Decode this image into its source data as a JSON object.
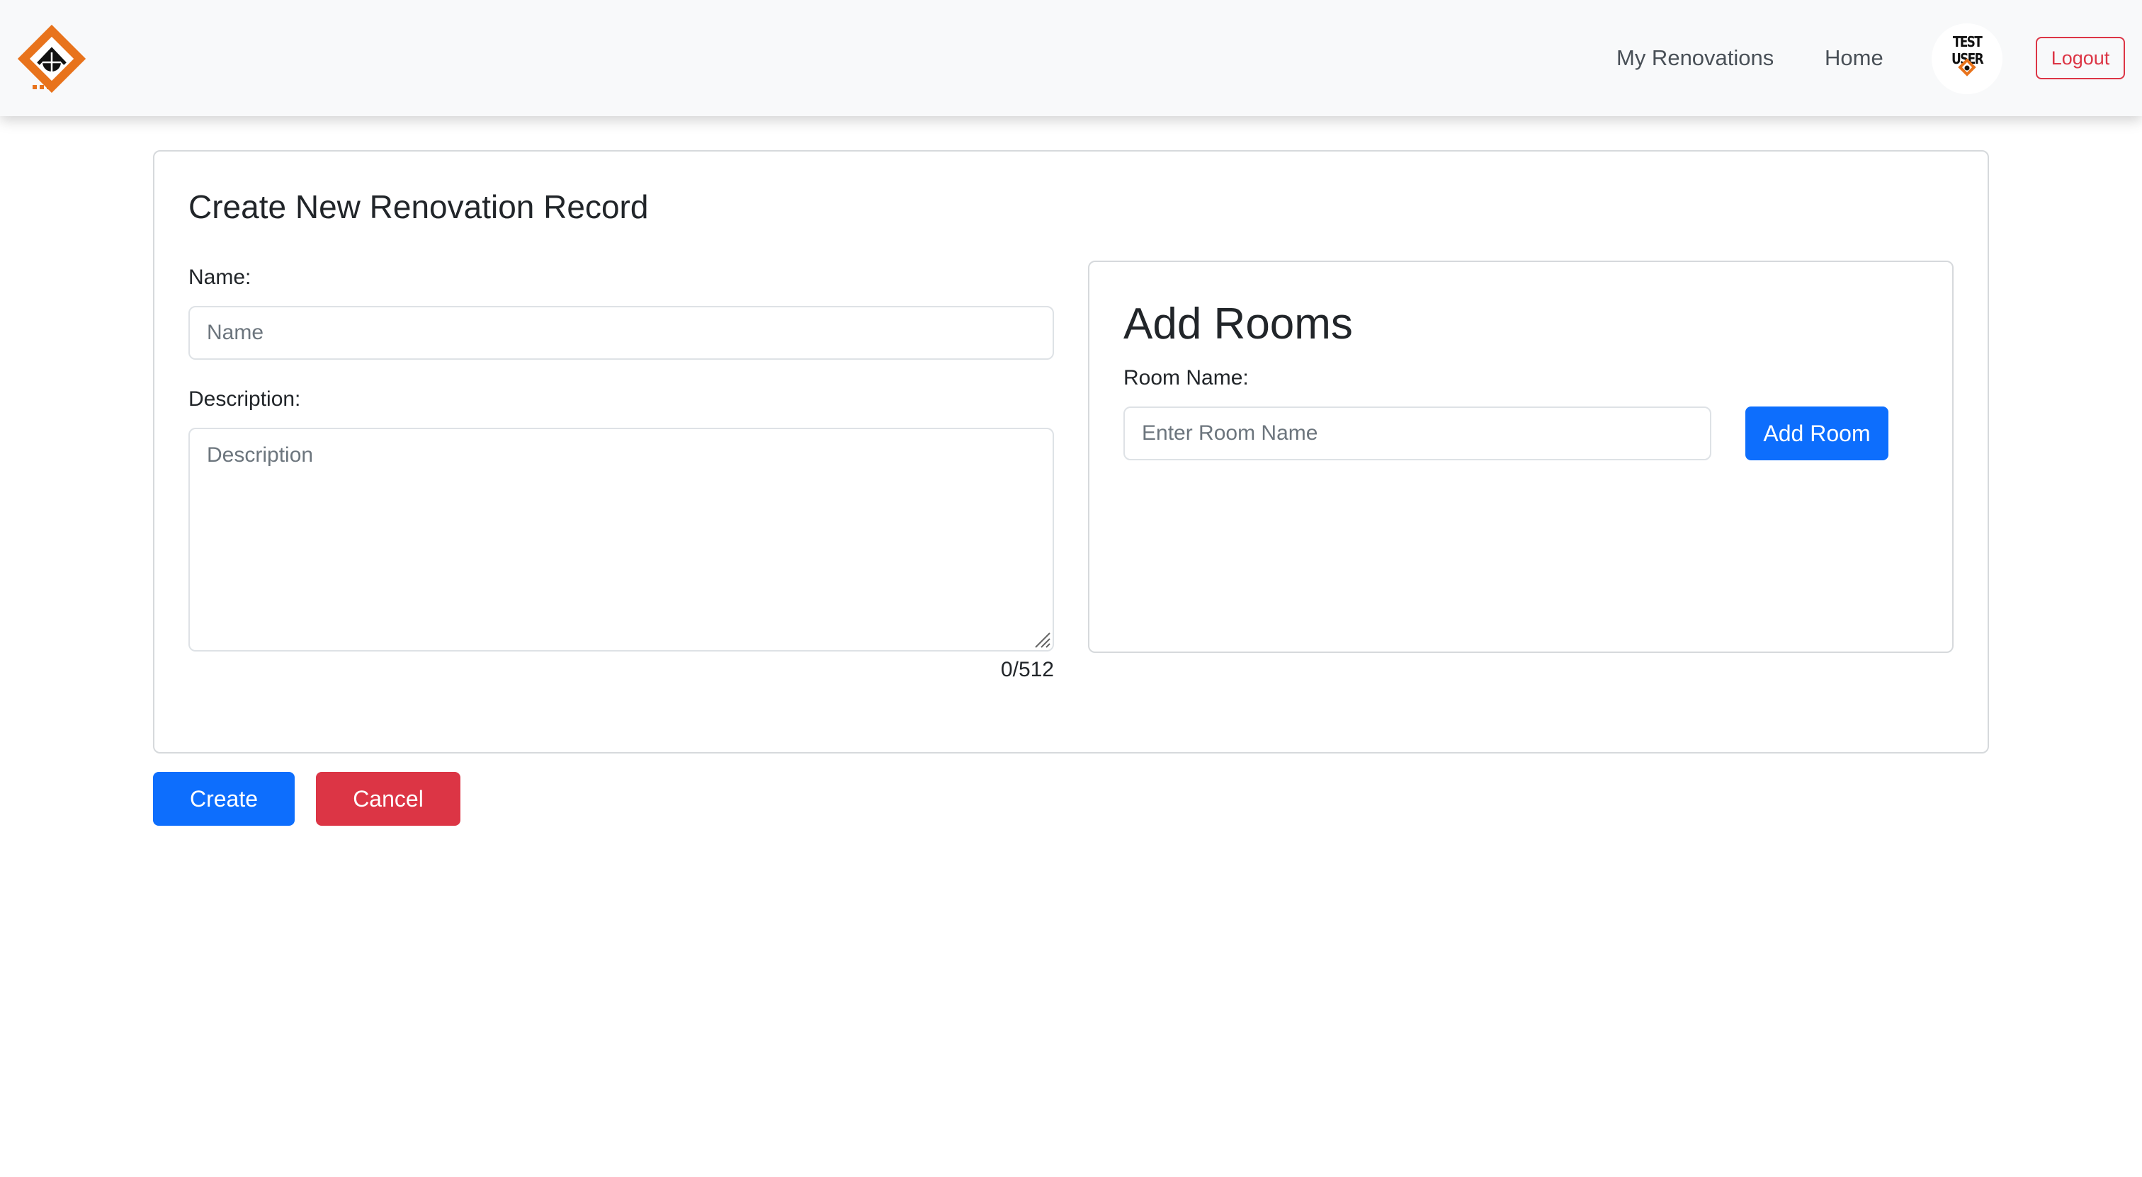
{
  "navbar": {
    "logo_icon": "renovation-house-logo-icon",
    "links": [
      {
        "label": "My Renovations"
      },
      {
        "label": "Home"
      }
    ],
    "avatar_text": "TEST USER",
    "logout_label": "Logout",
    "colors": {
      "accent": "#e8731c",
      "logout": "#dc3545"
    }
  },
  "form": {
    "title": "Create New Renovation Record",
    "name_label": "Name:",
    "name_placeholder": "Name",
    "name_value": "",
    "description_label": "Description:",
    "description_placeholder": "Description",
    "description_value": "",
    "char_count": "0/512"
  },
  "rooms": {
    "title": "Add Rooms",
    "room_name_label": "Room Name:",
    "room_name_placeholder": "Enter Room Name",
    "room_name_value": "",
    "add_button_label": "Add Room"
  },
  "actions": {
    "create_label": "Create",
    "cancel_label": "Cancel",
    "colors": {
      "primary": "#0d6efd",
      "danger": "#dc3545"
    }
  }
}
